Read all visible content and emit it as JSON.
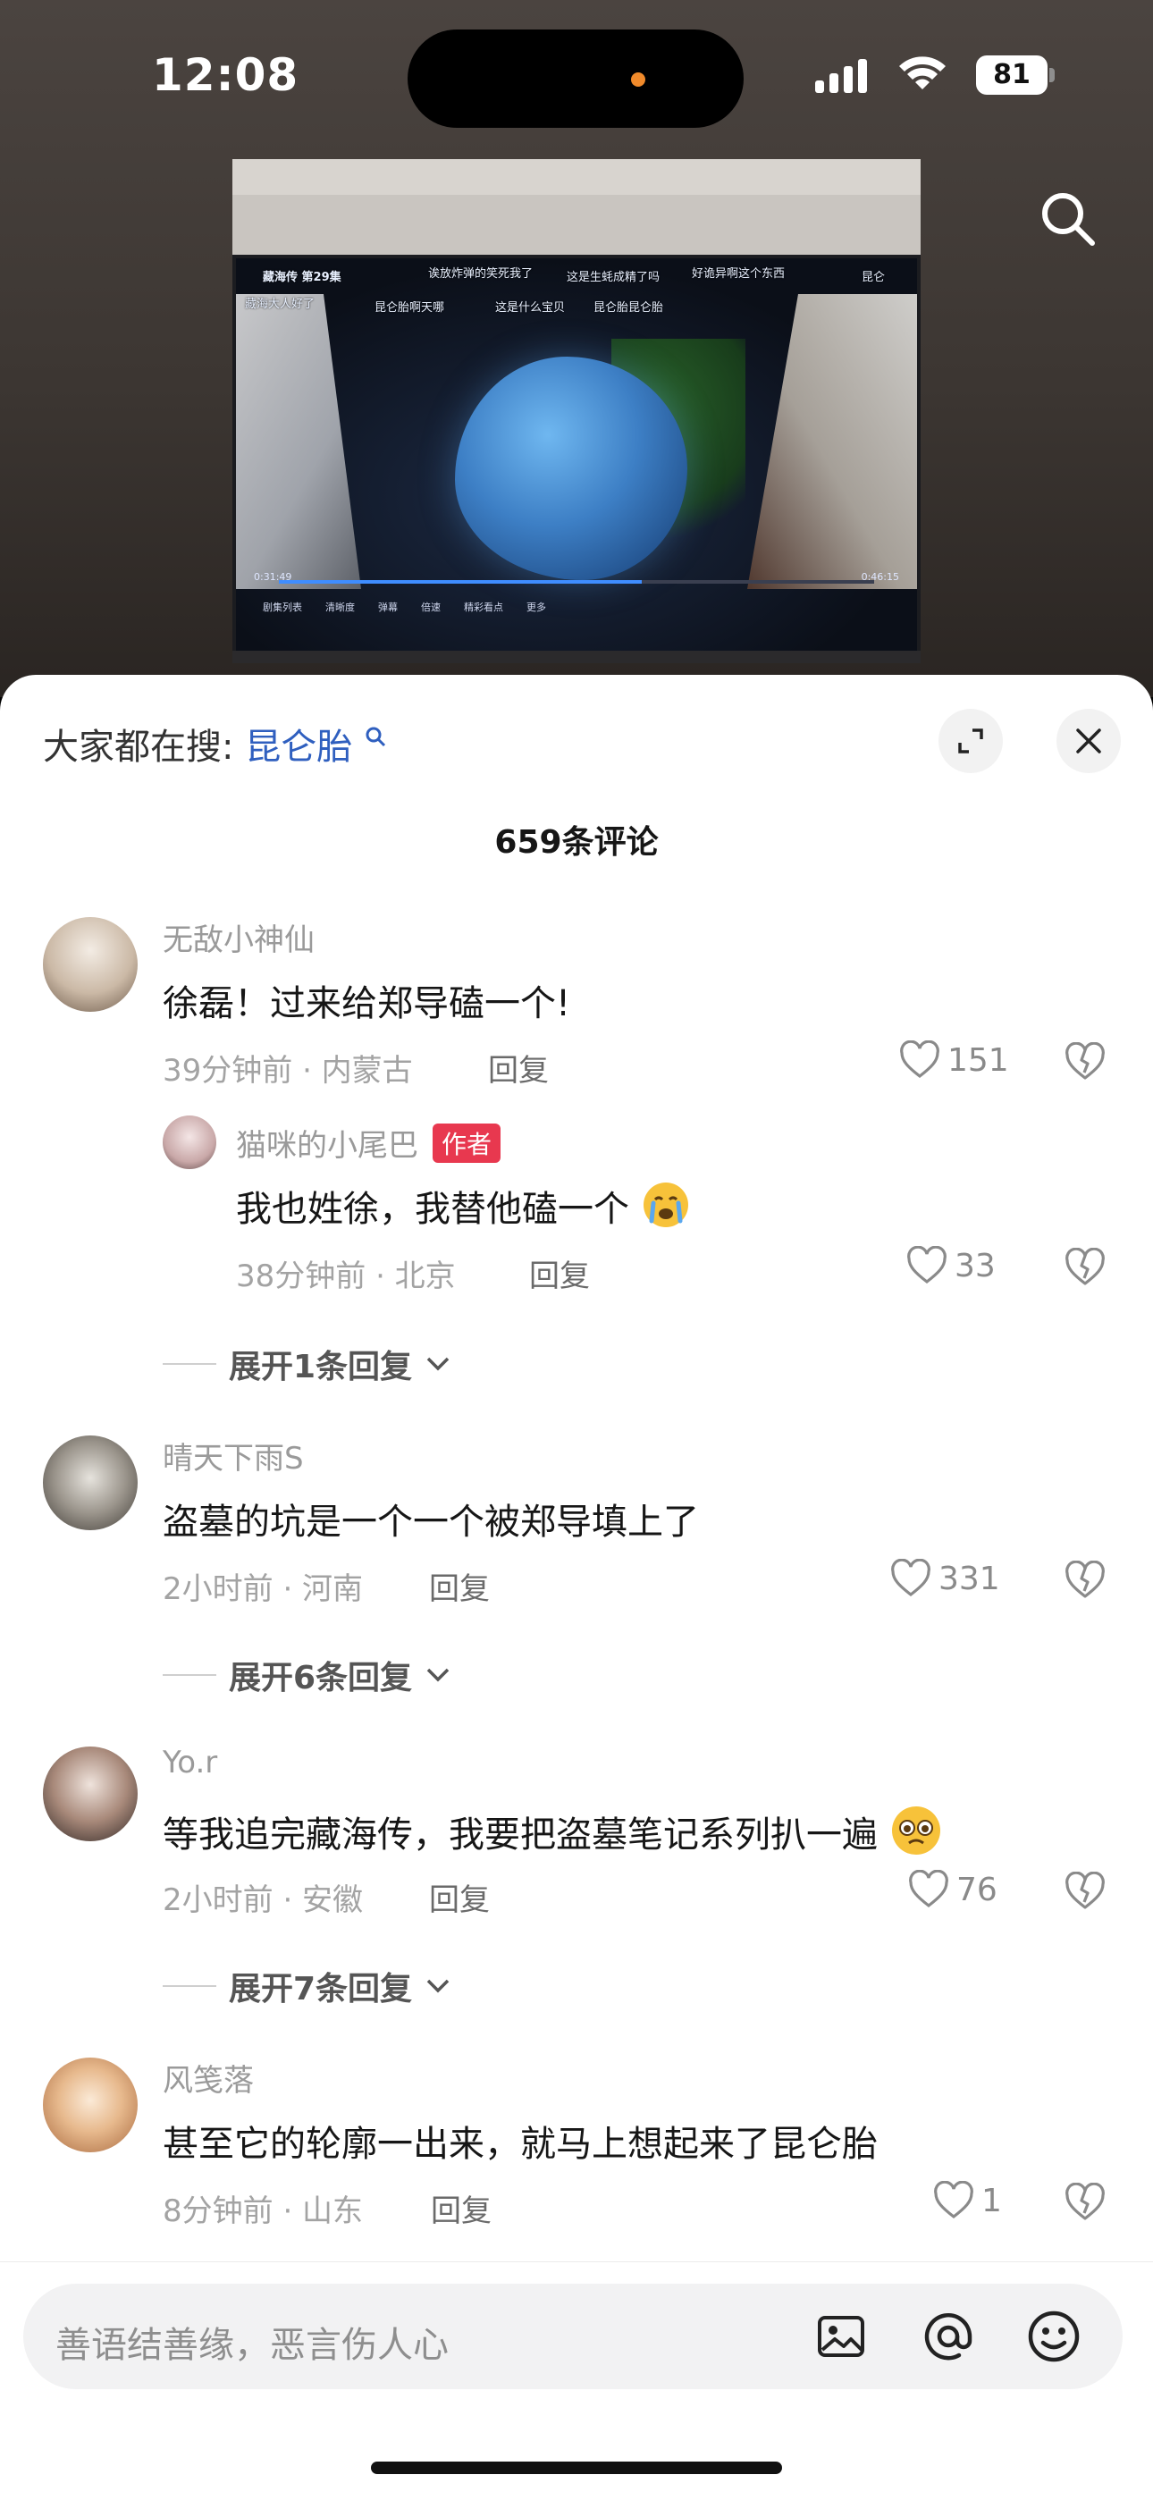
{
  "status_bar": {
    "time": "12:08",
    "battery": "81"
  },
  "video": {
    "danmaku": [
      "藏海传 第29集",
      "诶放炸弹的笑死我了",
      "这是生蚝成精了吗",
      "好诡异啊这个东西",
      "昆仑",
      "藏海大人好了",
      "昆仑胎啊天哪",
      "这是什么宝贝",
      "昆仑胎昆仑胎"
    ],
    "time_current": "0:31:49",
    "time_total": "0:46:15",
    "progress": 0.61,
    "menu": [
      "剧集列表",
      "清晰度",
      "弹幕",
      "倍速",
      "精彩看点",
      "更多"
    ]
  },
  "panel": {
    "hot_search_label": "大家都在搜:",
    "hot_search_keyword": "昆仑胎",
    "comment_count": "659条评论"
  },
  "comments": [
    {
      "name": "无敌小神仙",
      "text": "徐磊！过来给郑导磕一个!",
      "meta": "39分钟前 · 内蒙古",
      "reply": "回复",
      "likes": "151"
    },
    {
      "name": "晴天下雨S",
      "text": "盗墓的坑是一个一个被郑导填上了",
      "meta": "2小时前 · 河南",
      "reply": "回复",
      "likes": "331"
    },
    {
      "name": "Yo.r",
      "text": "等我追完藏海传，我要把盗墓笔记系列扒一遍",
      "meta": "2小时前 · 安徽",
      "reply": "回复",
      "likes": "76"
    },
    {
      "name": "风笺落",
      "text": "甚至它的轮廓一出来，就马上想起来了昆仑胎",
      "meta": "8分钟前 · 山东",
      "reply": "回复",
      "likes": "1"
    }
  ],
  "reply": {
    "name": "猫咪的小尾巴",
    "tag": "作者",
    "text": "我也姓徐，我替他磕一个",
    "meta": "38分钟前 · 北京",
    "reply": "回复",
    "likes": "33"
  },
  "expand": [
    "展开1条回复",
    "展开6条回复",
    "展开7条回复"
  ],
  "input": {
    "placeholder": "善语结善缘，恶言伤人心"
  }
}
